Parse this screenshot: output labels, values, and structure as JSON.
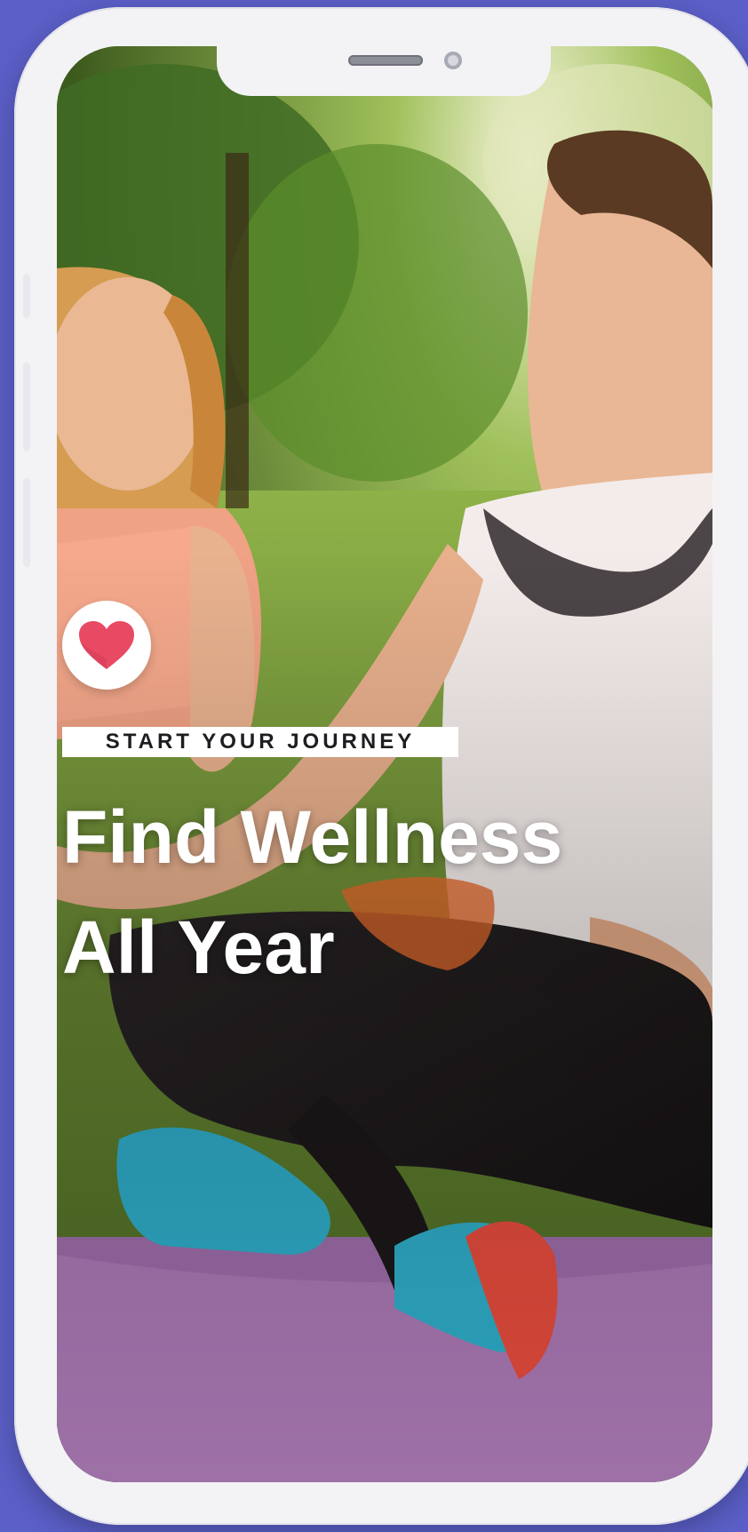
{
  "hero": {
    "label": "START YOUR JOURNEY",
    "headline_line1": "Find Wellness",
    "headline_line2": "All Year"
  },
  "icons": {
    "badge": "heart-icon"
  },
  "colors": {
    "background": "#5b5fc7",
    "heart": "#e84a64",
    "label_bg": "#ffffff",
    "headline": "#ffffff"
  }
}
